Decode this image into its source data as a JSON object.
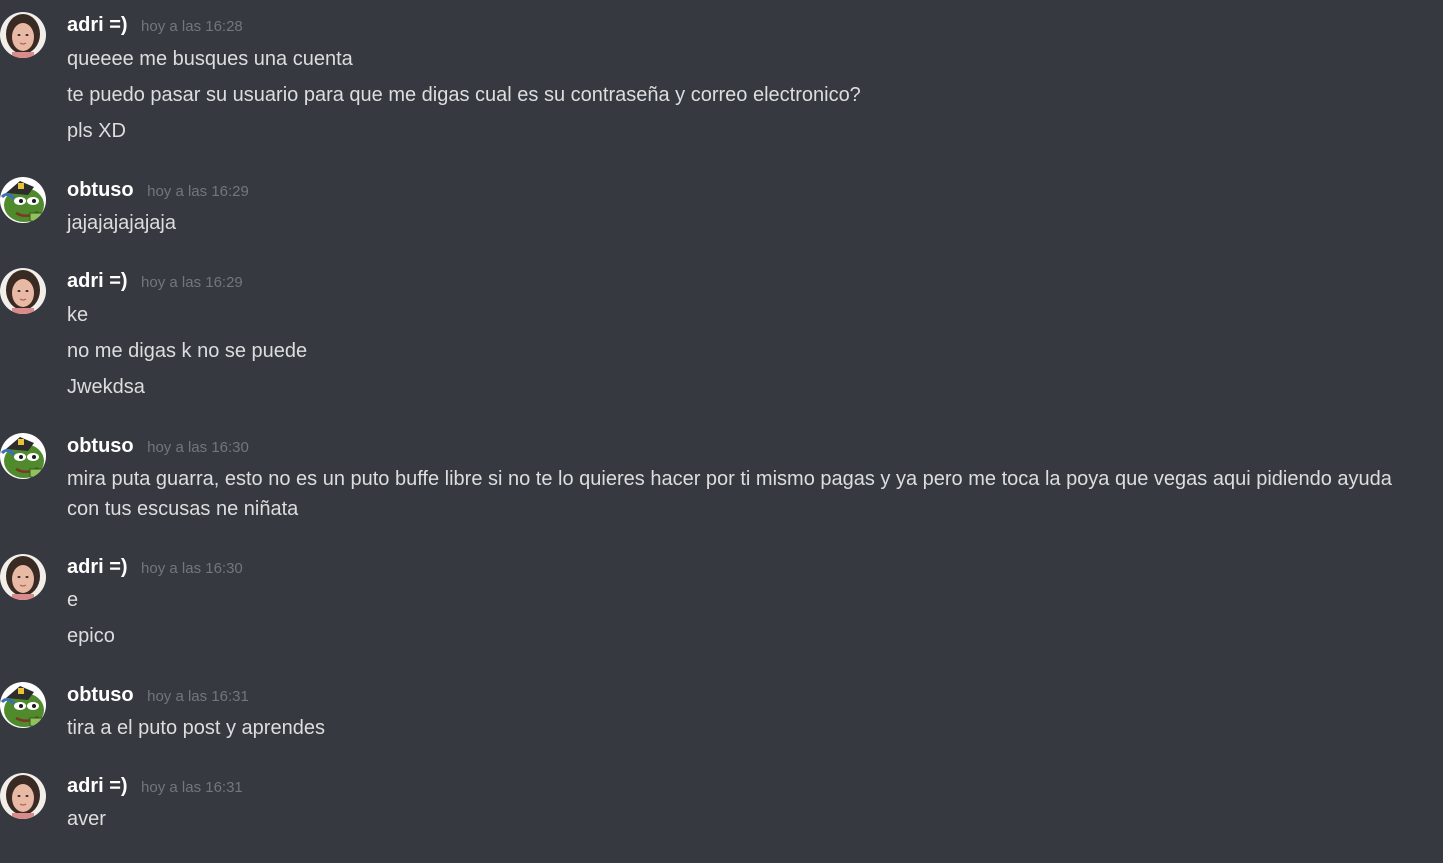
{
  "messages": [
    {
      "author": "adri =)",
      "timestamp": "hoy a las 16:28",
      "avatar": "girl-photo-avatar",
      "lines": [
        "queeee me busques una cuenta",
        "te puedo pasar su usuario para que me digas cual es su contraseña y correo electronico?",
        "pls XD"
      ]
    },
    {
      "author": "obtuso",
      "timestamp": "hoy a las 16:29",
      "avatar": "pepe-frog-avatar",
      "lines": [
        "jajajajajajaja"
      ]
    },
    {
      "author": "adri =)",
      "timestamp": "hoy a las 16:29",
      "avatar": "girl-photo-avatar",
      "lines": [
        "ke",
        "no me digas k no se puede",
        "Jwekdsa"
      ]
    },
    {
      "author": "obtuso",
      "timestamp": "hoy a las 16:30",
      "avatar": "pepe-frog-avatar",
      "lines": [
        "mira puta guarra, esto no es un puto buffe libre si no te lo quieres hacer por ti mismo pagas y ya pero me toca la poya que vegas aqui pidiendo ayuda con tus escusas ne niñata"
      ]
    },
    {
      "author": "adri =)",
      "timestamp": "hoy a las 16:30",
      "avatar": "girl-photo-avatar",
      "lines": [
        "e",
        "epico"
      ]
    },
    {
      "author": "obtuso",
      "timestamp": "hoy a las 16:31",
      "avatar": "pepe-frog-avatar",
      "lines": [
        "tira a el puto post y aprendes"
      ]
    },
    {
      "author": "adri =)",
      "timestamp": "hoy a las 16:31",
      "avatar": "girl-photo-avatar",
      "lines": [
        "aver"
      ]
    }
  ],
  "colors": {
    "background": "#36393f",
    "username": "#ffffff",
    "timestamp": "#72767d",
    "message_text": "#dcddde"
  }
}
